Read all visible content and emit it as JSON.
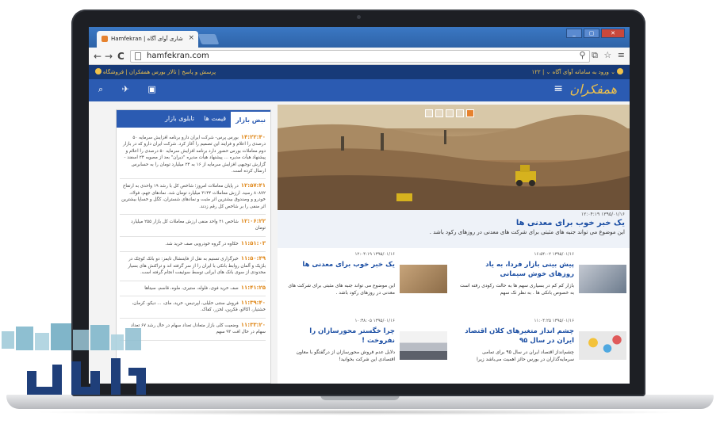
{
  "browser": {
    "tab_title": "Hamfekran | شاری آوای آگاه",
    "tab_close": "×",
    "url": "hamfekran.com",
    "nav_back": "←",
    "nav_forward": "→",
    "nav_reload": "C",
    "toolbar_right": "⚲ ⧉ ☆ ≡"
  },
  "site": {
    "top_left": "پرسش و پاسخ  |  تالار بورس همفکران  |  فروشگاه",
    "top_right": "ورود به سامانه آوای آگاه ⌄  |  ۱۲۲ ⌄",
    "logo": "همفکران",
    "menu_icon": "≡",
    "header_icons": "⌕ ✈ ▣"
  },
  "sidebar": {
    "tabs": [
      "نبض بازار",
      "قیمت ها",
      "تابلوی بازار"
    ],
    "news": [
      {
        "time": "۱۴:۲۲:۴۰",
        "text": "بورس پرس- شرکت ایران دارو برنامه افزایش سرمایه ۵۰ درصدی را اعلام و فرایند این تصمیم را آغاز کرد. شرکت ایران دارو که در بازار دوم معاملات بورس حضور دارد برنامه افزایش سرمایه ۵۰ درصدی را اعلام و پیشنهاد هیأت مدیره ... پیشنهاد هیأت مدیره \"دیران\" بعد از مصوبه ۲۴ اسفند - گزارش توجیهی افزایش سرمایه از ۱۶ به ۲۴ میلیارد تومان را به حسابرس ارسال کرده است."
      },
      {
        "time": "۱۲:۵۷:۴۱",
        "text": "در پایان معاملات امروز؛ شاخص کل با رشد ۱۹ واحدی به ارتفاع ۸۰۸۷۲ رسید. ارزش معاملات ۳۱۴۴ میلیارد تومان شد. نمادهای جهم، فولاد، خودرو و وصندوق بیشترین اثر مثبت و نمادهای شستران، کگل و خساپا بیشترین اثر منفی را بر شاخص کل رقم زدند."
      },
      {
        "time": "۱۲:۰۶:۲۲",
        "text": "شاخص ۲۱ واحد منفی ارزش معاملات کل بازار ۲۵۵ میلیارد تومان"
      },
      {
        "time": "۱۱:۵۱:۰۳",
        "text": "خکاوه در گروه خودرویی صف خرید شد."
      },
      {
        "time": "۱۱:۵۰:۴۹",
        "text": "خبرگزاری تسنیم به نقل از فایننشال تایمز: دو بانک کوچک در بلژیک و آلمان روابط بانکی با ایران را از سر گرفته اند و تراکنش های بسیار محدودی از سوی بانک های ایرانی توسط سوئیفت انجام گرفته است."
      },
      {
        "time": "۱۱:۴۱:۲۵",
        "text": "صف خرید فوی، فلوله، ستیری، ملوه، قاسم، سیتاها"
      },
      {
        "time": "۱۱:۳۹:۴۰",
        "text": "فروش ستنی خلیلی، لپردیس، خرید، مای، ... دیکو، کرمان، خشتیار، اکالاو، فکرین، لخزر، کفاک."
      },
      {
        "time": "۱۱:۳۳:۲۰",
        "text": "وضعیت کلی بازار متعادل تعداد سهام در حال رشد ۶۷ تعداد سهام در حال افت ۹۳ سهم"
      }
    ]
  },
  "main": {
    "hero": {
      "date": "۱۳۹۵/۰۱/۱۶ ۱۲:۰۴:۱۹",
      "title": "یک خبر خوب برای معدنی ها",
      "desc": "این موضوع می تواند جنبه های مثبتی برای شرکت های معدنی در روزهای رکود باشد .",
      "dots": [
        "1",
        "2",
        "3",
        "4",
        "5"
      ]
    },
    "cards": [
      {
        "date": "۱۳۹۵/۰۱/۱۶ ۱۶:۵۴:۰۲",
        "title": "پیش بینی بازار فردا، به یاد روزهای خوش سیمانی",
        "desc": "بازار کم کم در بسیاری سهم ها به حالت رکودی رفته است به خصوص بانکی ها . به نظر تک سهم"
      },
      {
        "date": "۱۳۹۵/۰۱/۱۶ ۱۲:۰۴:۱۹",
        "title": "یک خبر خوب برای معدنی ها",
        "desc": "این موضوع می تواند جنبه های مثبتی برای شرکت های معدنی در روزهای رکود باشد ."
      },
      {
        "date": "۱۳۹۵/۰۱/۱۶ ۱۱:۰۴:۲۵",
        "title": "چشم انداز متغیرهای کلان اقتصاد ایران در سال ۹۵",
        "desc": "چشم‌انداز اقتصاد ایران در سال ۹۵ برای تمامی سرمایه‌گذاران در بورس حائز اهمیت می‌باشد زیرا"
      },
      {
        "date": "۱۳۹۵/۰۱/۱۶ ۱۰:۳۸:۰۵",
        "title": "چرا خگستر محورسازان را نفروخت !",
        "desc": "دلایل عدم فروش محورسازان از درگفتگو با معاون اقتصادی این شرکت بخوانید!"
      }
    ]
  },
  "watermark": {
    "text": "پاسگاه"
  },
  "colors": {
    "primary": "#2b5bb2",
    "dark": "#173a78",
    "accent": "#f0c24a",
    "time": "#e08a1e"
  }
}
